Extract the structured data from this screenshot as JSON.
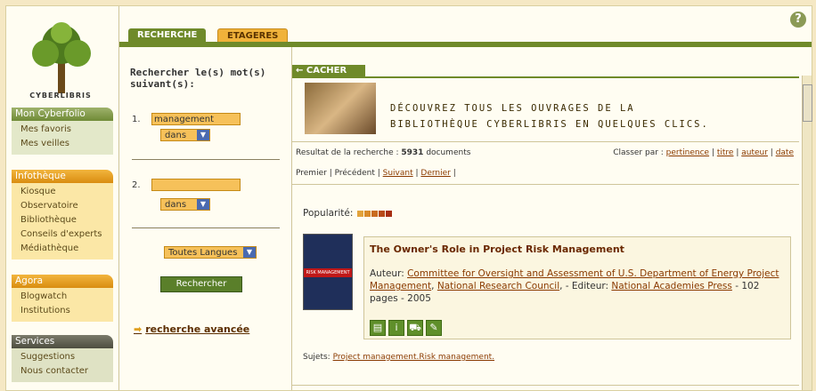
{
  "logo": {
    "text": "CYBERLIBRIS"
  },
  "nav": {
    "sections": [
      {
        "title": "Mon Cyberfolio",
        "items": [
          "Mes favoris",
          "Mes veilles"
        ]
      },
      {
        "title": "Infothèque",
        "items": [
          "Kiosque",
          "Observatoire",
          "Bibliothèque",
          "Conseils d'experts",
          "Médiathèque"
        ]
      },
      {
        "title": "Agora",
        "items": [
          "Blogwatch",
          "Institutions"
        ]
      },
      {
        "title": "Services",
        "items": [
          "Suggestions",
          "Nous contacter"
        ]
      }
    ]
  },
  "tabs": {
    "recherche": "RECHERCHE",
    "etageres": "ETAGERES"
  },
  "help": {
    "icon": "?"
  },
  "search": {
    "title_line1": "Rechercher le(s) mot(s)",
    "title_line2": "suivant(s):",
    "field1_num": "1.",
    "field1_value": "management",
    "field1_scope": "dans",
    "field2_num": "2.",
    "field2_value": "",
    "field2_scope": "dans",
    "language": "Toutes Langues",
    "button": "Rechercher",
    "advanced": "recherche avancée"
  },
  "content": {
    "cacher": "← CACHER",
    "banner_line1": "DÉCOUVREZ TOUS LES OUVRAGES DE LA",
    "banner_line2": "BIBLIOTHÈQUE CYBERLIBRIS EN QUELQUES CLICS.",
    "result_prefix": "Resultat de la recherche : ",
    "result_count": "5931",
    "result_suffix": " documents",
    "sort_label": "Classer par : ",
    "sort_options": [
      "pertinence",
      "titre",
      "auteur",
      "date"
    ],
    "pager": {
      "first": "Premier",
      "prev": "Précédent",
      "next": "Suivant",
      "last": "Dernier"
    },
    "popularity_label": "Popularité:",
    "popularity_colors": [
      "#e2a33c",
      "#d98b2a",
      "#c96b1f",
      "#b84a18",
      "#a72e12"
    ]
  },
  "book": {
    "cover_band": "RISK MANAGEMENT",
    "title": "The Owner's Role in Project Risk Management",
    "author_label": "Auteur: ",
    "authors": "Committee for Oversight and Assessment of U.S. Department of Energy Project Management",
    "author2": "National Research Council",
    "editor_label": ", - Editeur: ",
    "editor": "National Academies Press",
    "details": " - 102 pages - 2005",
    "subjects_label": "Sujets: ",
    "subjects": "Project management.Risk management."
  }
}
